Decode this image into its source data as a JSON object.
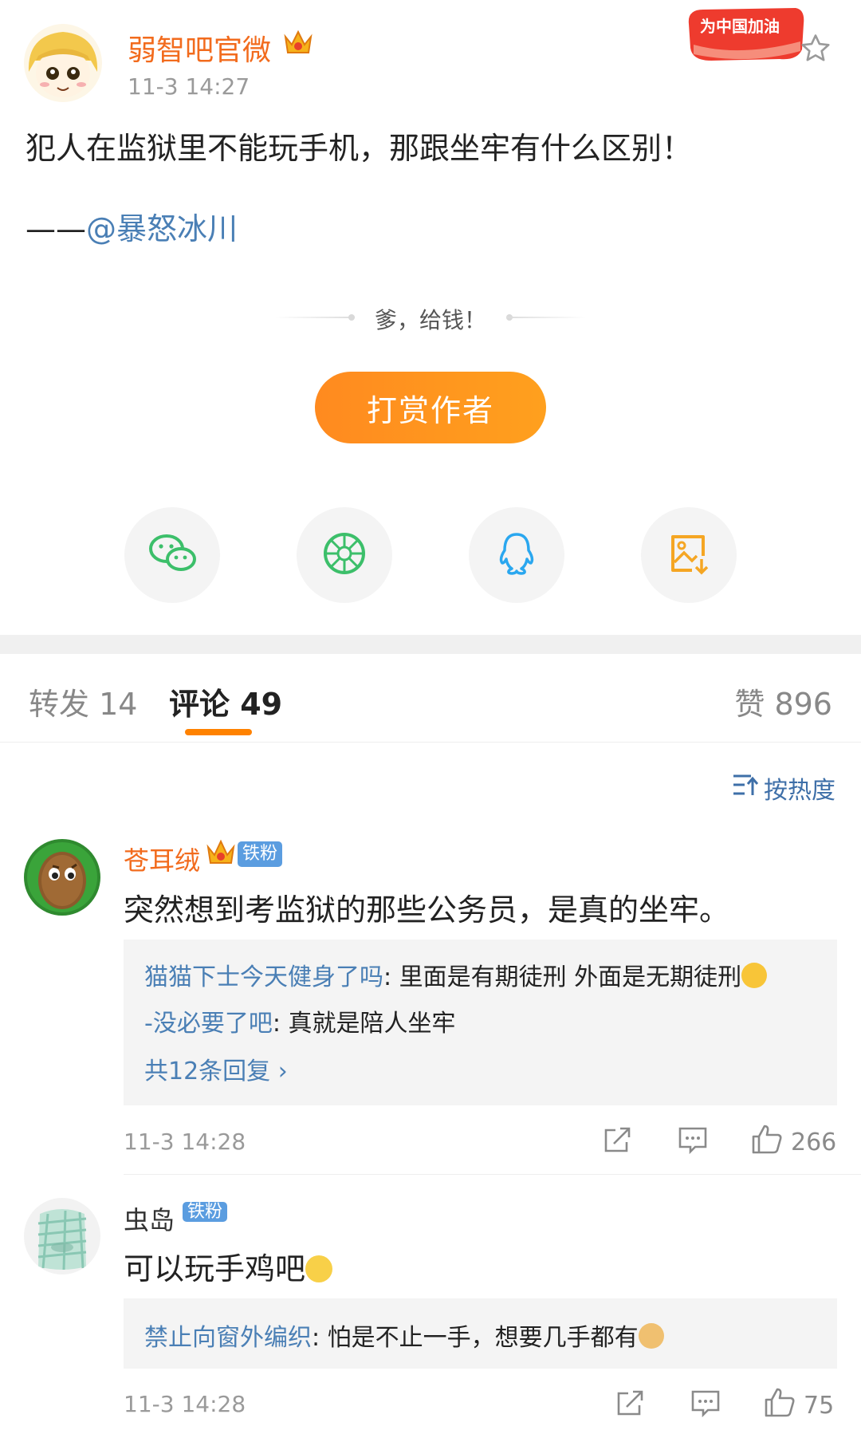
{
  "post": {
    "author": "弱智吧官微",
    "time": "11-3 14:27",
    "promo_label": "为中国加油",
    "text": "犯人在监狱里不能玩手机，那跟坐牢有什么区别！",
    "mention_prefix": "——",
    "mention": "@暴怒冰川"
  },
  "reward": {
    "prompt": "爹，给钱！",
    "button_label": "打赏作者"
  },
  "share": [
    {
      "icon": "wechat-icon"
    },
    {
      "icon": "moments-icon"
    },
    {
      "icon": "qq-icon"
    },
    {
      "icon": "save-image-icon"
    }
  ],
  "tabs": {
    "repost": "转发 14",
    "comments": "评论 49",
    "likes": "赞 896"
  },
  "sort_label": "按热度",
  "comments": [
    {
      "user": "苍耳绒",
      "badge": "铁粉",
      "text": "突然想到考监狱的那些公务员，是真的坐牢。",
      "replies": [
        {
          "user": "猫猫下士今天健身了吗",
          "text": ": 里面是有期徒刑 外面是无期徒刑"
        },
        {
          "user": "-没必要了吧",
          "text": ": 真就是陪人坐牢"
        }
      ],
      "more_replies": "共12条回复 ›",
      "time": "11-3 14:28",
      "likes": "266"
    },
    {
      "user": "虫岛",
      "badge": "铁粉",
      "text": "可以玩手鸡吧",
      "replies": [
        {
          "user": "禁止向窗外编织",
          "text": ": 怕是不止一手，想要几手都有"
        }
      ],
      "time": "11-3 14:28",
      "likes": "75"
    }
  ],
  "colors": {
    "accent": "#ff8200",
    "link": "#4a7fb5",
    "author": "#f26b1d"
  }
}
